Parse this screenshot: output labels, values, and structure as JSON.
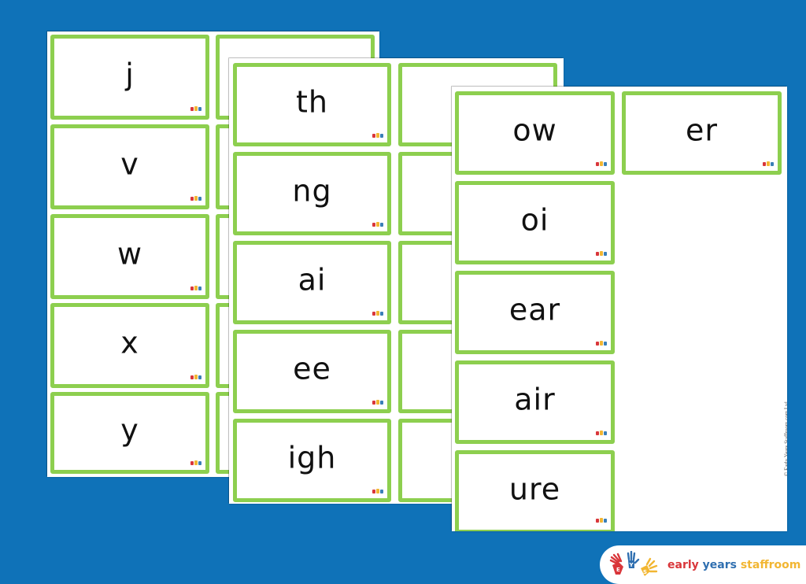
{
  "colors": {
    "background": "#0f72b8",
    "card_border": "#8dcf4f",
    "brand_red": "#d9363a",
    "brand_blue": "#2f6fb0",
    "brand_yellow": "#f2b632"
  },
  "sheets": [
    {
      "name": "sheet-1",
      "cards": [
        {
          "label": "j"
        },
        {
          "label": ""
        },
        {
          "label": "v"
        },
        {
          "label": ""
        },
        {
          "label": "w"
        },
        {
          "label": ""
        },
        {
          "label": "x"
        },
        {
          "label": ""
        },
        {
          "label": "y"
        },
        {
          "label": ""
        }
      ]
    },
    {
      "name": "sheet-2",
      "cards": [
        {
          "label": "th"
        },
        {
          "label": ""
        },
        {
          "label": "ng"
        },
        {
          "label": ""
        },
        {
          "label": "ai"
        },
        {
          "label": ""
        },
        {
          "label": "ee"
        },
        {
          "label": ""
        },
        {
          "label": "igh"
        },
        {
          "label": ""
        }
      ]
    },
    {
      "name": "sheet-3",
      "cards": [
        {
          "label": "ow"
        },
        {
          "label": "er"
        },
        {
          "label": "oi"
        },
        {
          "label": "ear"
        },
        {
          "label": "air"
        },
        {
          "label": "ure"
        }
      ],
      "copyright": "© Early Years Staffroom.com Ltd"
    }
  ],
  "brand": {
    "word1": "early",
    "word2": "years",
    "word3": "staffroom",
    "hand_letters": [
      "E",
      "Y",
      "S"
    ]
  }
}
